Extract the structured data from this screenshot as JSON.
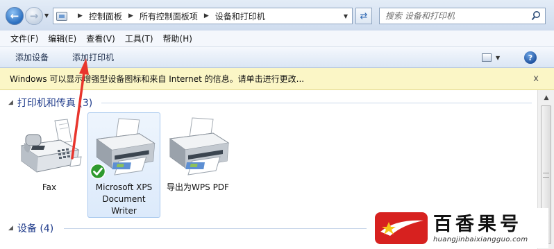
{
  "address_bar": {
    "breadcrumbs": [
      "控制面板",
      "所有控制面板项",
      "设备和打印机"
    ],
    "search_placeholder": "搜索 设备和打印机"
  },
  "menu": [
    "文件(F)",
    "编辑(E)",
    "查看(V)",
    "工具(T)",
    "帮助(H)"
  ],
  "toolbar": {
    "add_device": "添加设备",
    "add_printer": "添加打印机"
  },
  "infobar": {
    "message": "Windows 可以显示增强型设备图标和来自 Internet 的信息。请单击进行更改...",
    "close": "x"
  },
  "groups": {
    "printers": {
      "title": "打印机和传真 (3)",
      "items": [
        {
          "lines": [
            "Fax"
          ],
          "icon": "fax-icon",
          "selected": false
        },
        {
          "lines": [
            "Microsoft XPS",
            "Document",
            "Writer"
          ],
          "icon": "printer-icon",
          "selected": true,
          "default": true
        },
        {
          "lines": [
            "导出为WPS PDF"
          ],
          "icon": "printer-icon",
          "selected": false
        }
      ]
    },
    "devices": {
      "title": "设备 (4)"
    }
  },
  "watermark": {
    "title": "百香果号",
    "url": "huangjinbaixiangguo.com"
  },
  "colors": {
    "annotation_arrow": "#e8352d",
    "infobar_bg": "#fbf6c6",
    "group_title": "#1e3a8a",
    "default_check": "#2e9a2e"
  }
}
